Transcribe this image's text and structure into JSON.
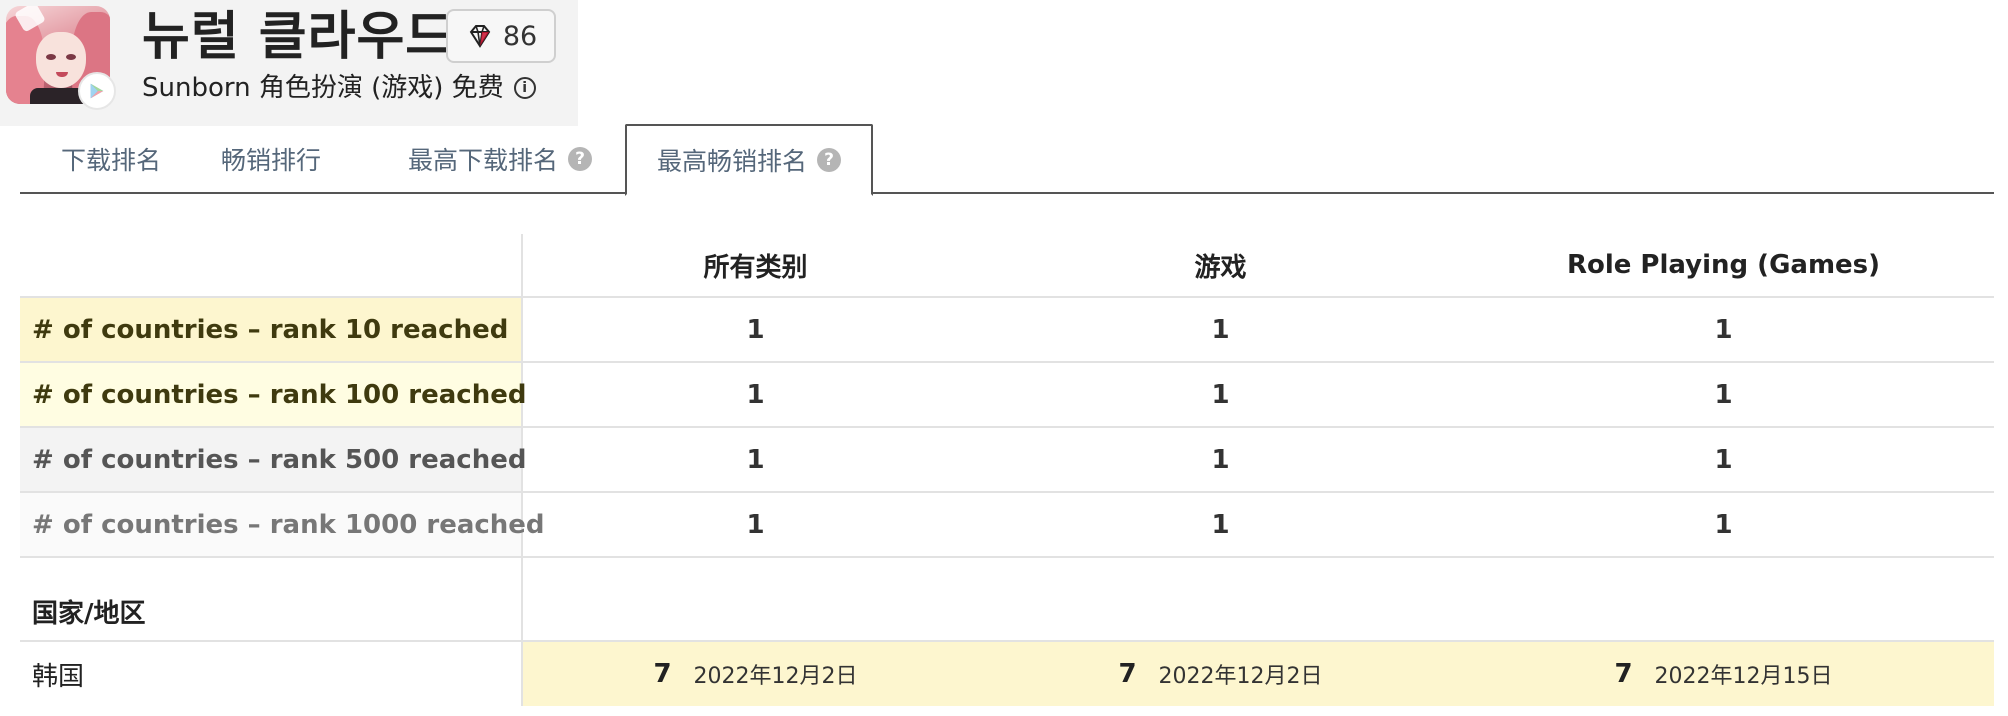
{
  "app": {
    "title": "뉴럴 클라우드",
    "gem_count": "86",
    "subtitle": "Sunborn 角色扮演 (游戏) 免费",
    "info_glyph": "i"
  },
  "tabs": [
    {
      "label": "下载排名",
      "help": false
    },
    {
      "label": "畅销排行",
      "help": false
    },
    {
      "label": "最高下载排名",
      "help": true
    },
    {
      "label": "最高畅销排名",
      "help": true,
      "active": true
    }
  ],
  "help_glyph": "?",
  "table": {
    "columns": [
      "所有类别",
      "游戏",
      "Role Playing (Games)"
    ],
    "rows": [
      {
        "label": "# of countries – rank 10 reached",
        "values": [
          "1",
          "1",
          "1"
        ]
      },
      {
        "label": "# of countries – rank 100 reached",
        "values": [
          "1",
          "1",
          "1"
        ]
      },
      {
        "label": "# of countries – rank 500 reached",
        "values": [
          "1",
          "1",
          "1"
        ]
      },
      {
        "label": "# of countries – rank 1000 reached",
        "values": [
          "1",
          "1",
          "1"
        ]
      }
    ],
    "region_header": "国家/地区",
    "regions": [
      {
        "name": "韩国",
        "ranks": [
          {
            "rank": "7",
            "date": "2022年12月2日"
          },
          {
            "rank": "7",
            "date": "2022年12月2日"
          },
          {
            "rank": "7",
            "date": "2022年12月15日"
          }
        ]
      }
    ]
  },
  "colors": {
    "tab_text": "#55677a",
    "highlight_yellow": "#fdf6cf",
    "gem_accent": "#c8102e"
  }
}
